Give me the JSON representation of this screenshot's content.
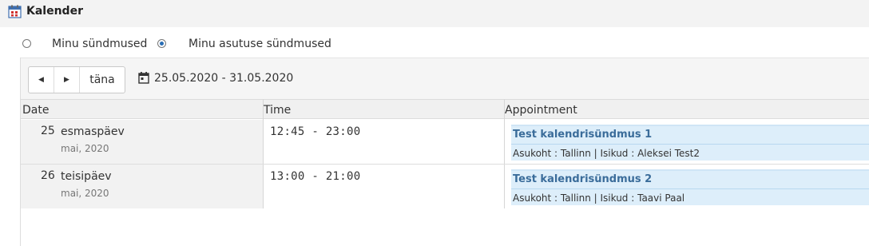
{
  "header": {
    "title": "Kalender",
    "icon": "calendar-icon"
  },
  "filters": {
    "options": [
      {
        "label": "Minu sündmused",
        "selected": false
      },
      {
        "label": "Minu asutuse sündmused",
        "selected": true
      }
    ]
  },
  "toolbar": {
    "prev_icon": "◀",
    "next_icon": "▶",
    "today_label": "täna",
    "date_range": "25.05.2020 - 31.05.2020",
    "range_icon": "calendar-icon"
  },
  "columns": {
    "date": "Date",
    "time": "Time",
    "appointment": "Appointment"
  },
  "rows": [
    {
      "day": "25",
      "weekday": "esmaspäev",
      "month": "mai, 2020",
      "time": "12:45 - 23:00",
      "title": "Test kalendrisündmus 1",
      "meta": "Asukoht : Tallinn | Isikud : Aleksei Test2"
    },
    {
      "day": "26",
      "weekday": "teisipäev",
      "month": "mai, 2020",
      "time": "13:00 - 21:00",
      "title": "Test kalendrisündmus 2",
      "meta": "Asukoht : Tallinn | Isikud : Taavi Paal"
    }
  ],
  "colors": {
    "accent": "#2a6eb5",
    "event_bg": "#ddeefa",
    "event_title": "#3a6c9a"
  }
}
